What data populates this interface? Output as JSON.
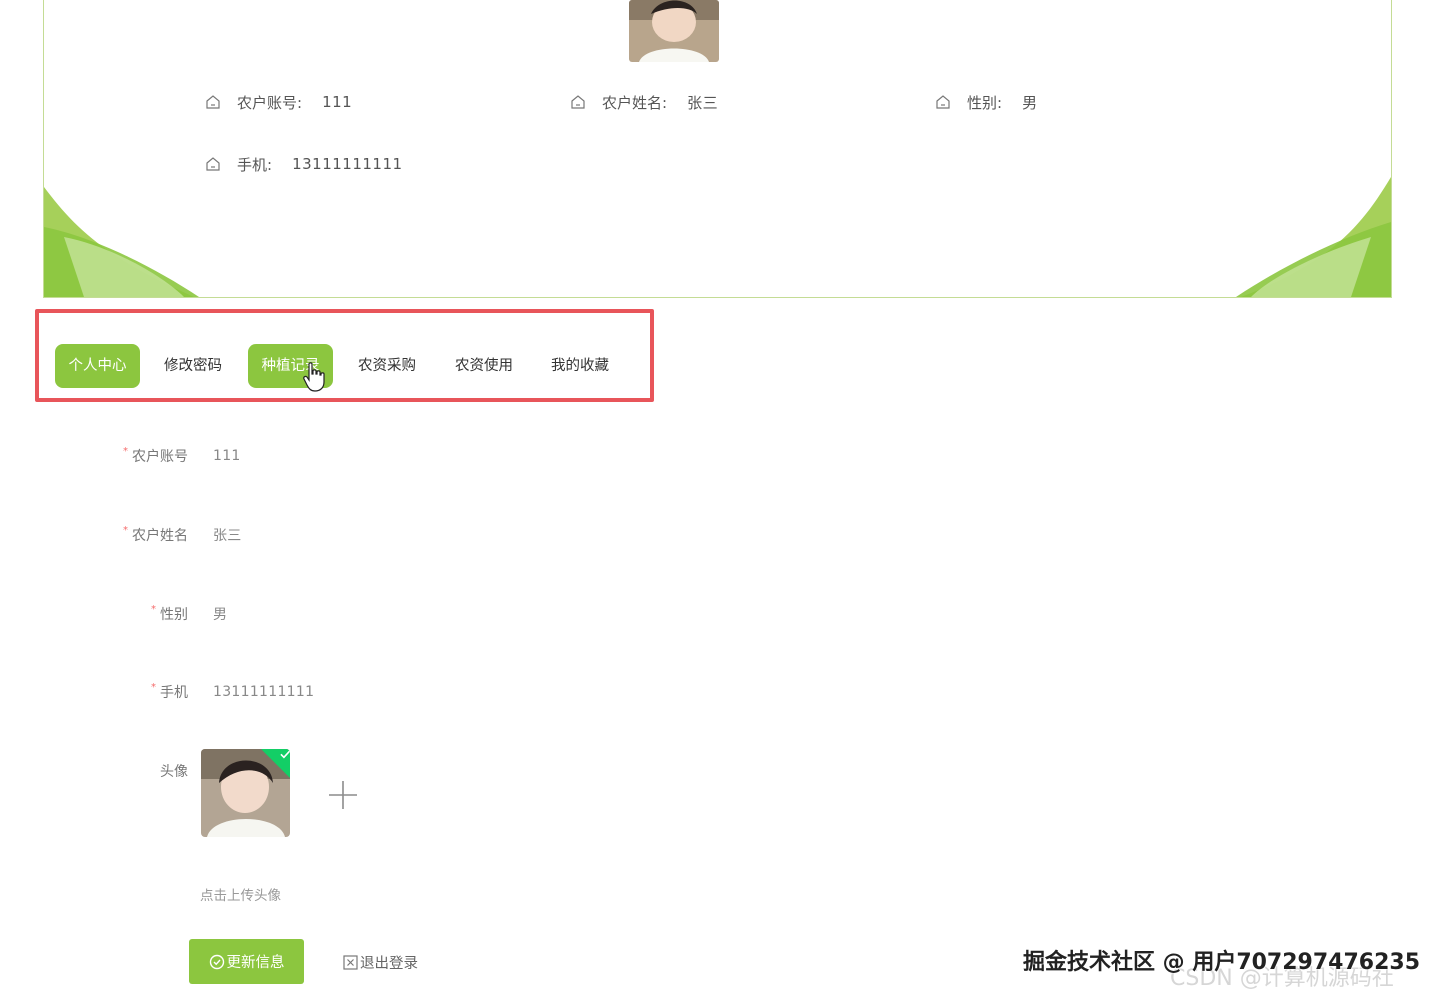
{
  "colors": {
    "accent": "#8cc63f",
    "highlight_border": "#e8555a",
    "required": "#f56c6c",
    "upload_success": "#13ce66"
  },
  "profile": {
    "account": {
      "icon": "home-icon",
      "label": "农户账号:",
      "value": "111"
    },
    "name": {
      "icon": "home-icon",
      "label": "农户姓名:",
      "value": "张三"
    },
    "gender": {
      "icon": "home-icon",
      "label": "性别:",
      "value": "男"
    },
    "phone": {
      "icon": "home-icon",
      "label": "手机:",
      "value": "13111111111"
    }
  },
  "tabs": [
    {
      "label": "个人中心",
      "active": true
    },
    {
      "label": "修改密码",
      "active": false
    },
    {
      "label": "种植记录",
      "active": true
    },
    {
      "label": "农资采购",
      "active": false
    },
    {
      "label": "农资使用",
      "active": false
    },
    {
      "label": "我的收藏",
      "active": false
    }
  ],
  "form": {
    "required_mark": "*",
    "account": {
      "label": "农户账号",
      "value": "111"
    },
    "name": {
      "label": "农户姓名",
      "value": "张三"
    },
    "gender": {
      "label": "性别",
      "value": "男"
    },
    "phone": {
      "label": "手机",
      "value": "13111111111"
    },
    "avatar": {
      "label": "头像",
      "hint": "点击上传头像"
    }
  },
  "buttons": {
    "update": "更新信息",
    "logout": "退出登录"
  },
  "watermark": {
    "primary": "掘金技术社区 @ 用户707297476235",
    "secondary": "CSDN @计算机源码社"
  }
}
